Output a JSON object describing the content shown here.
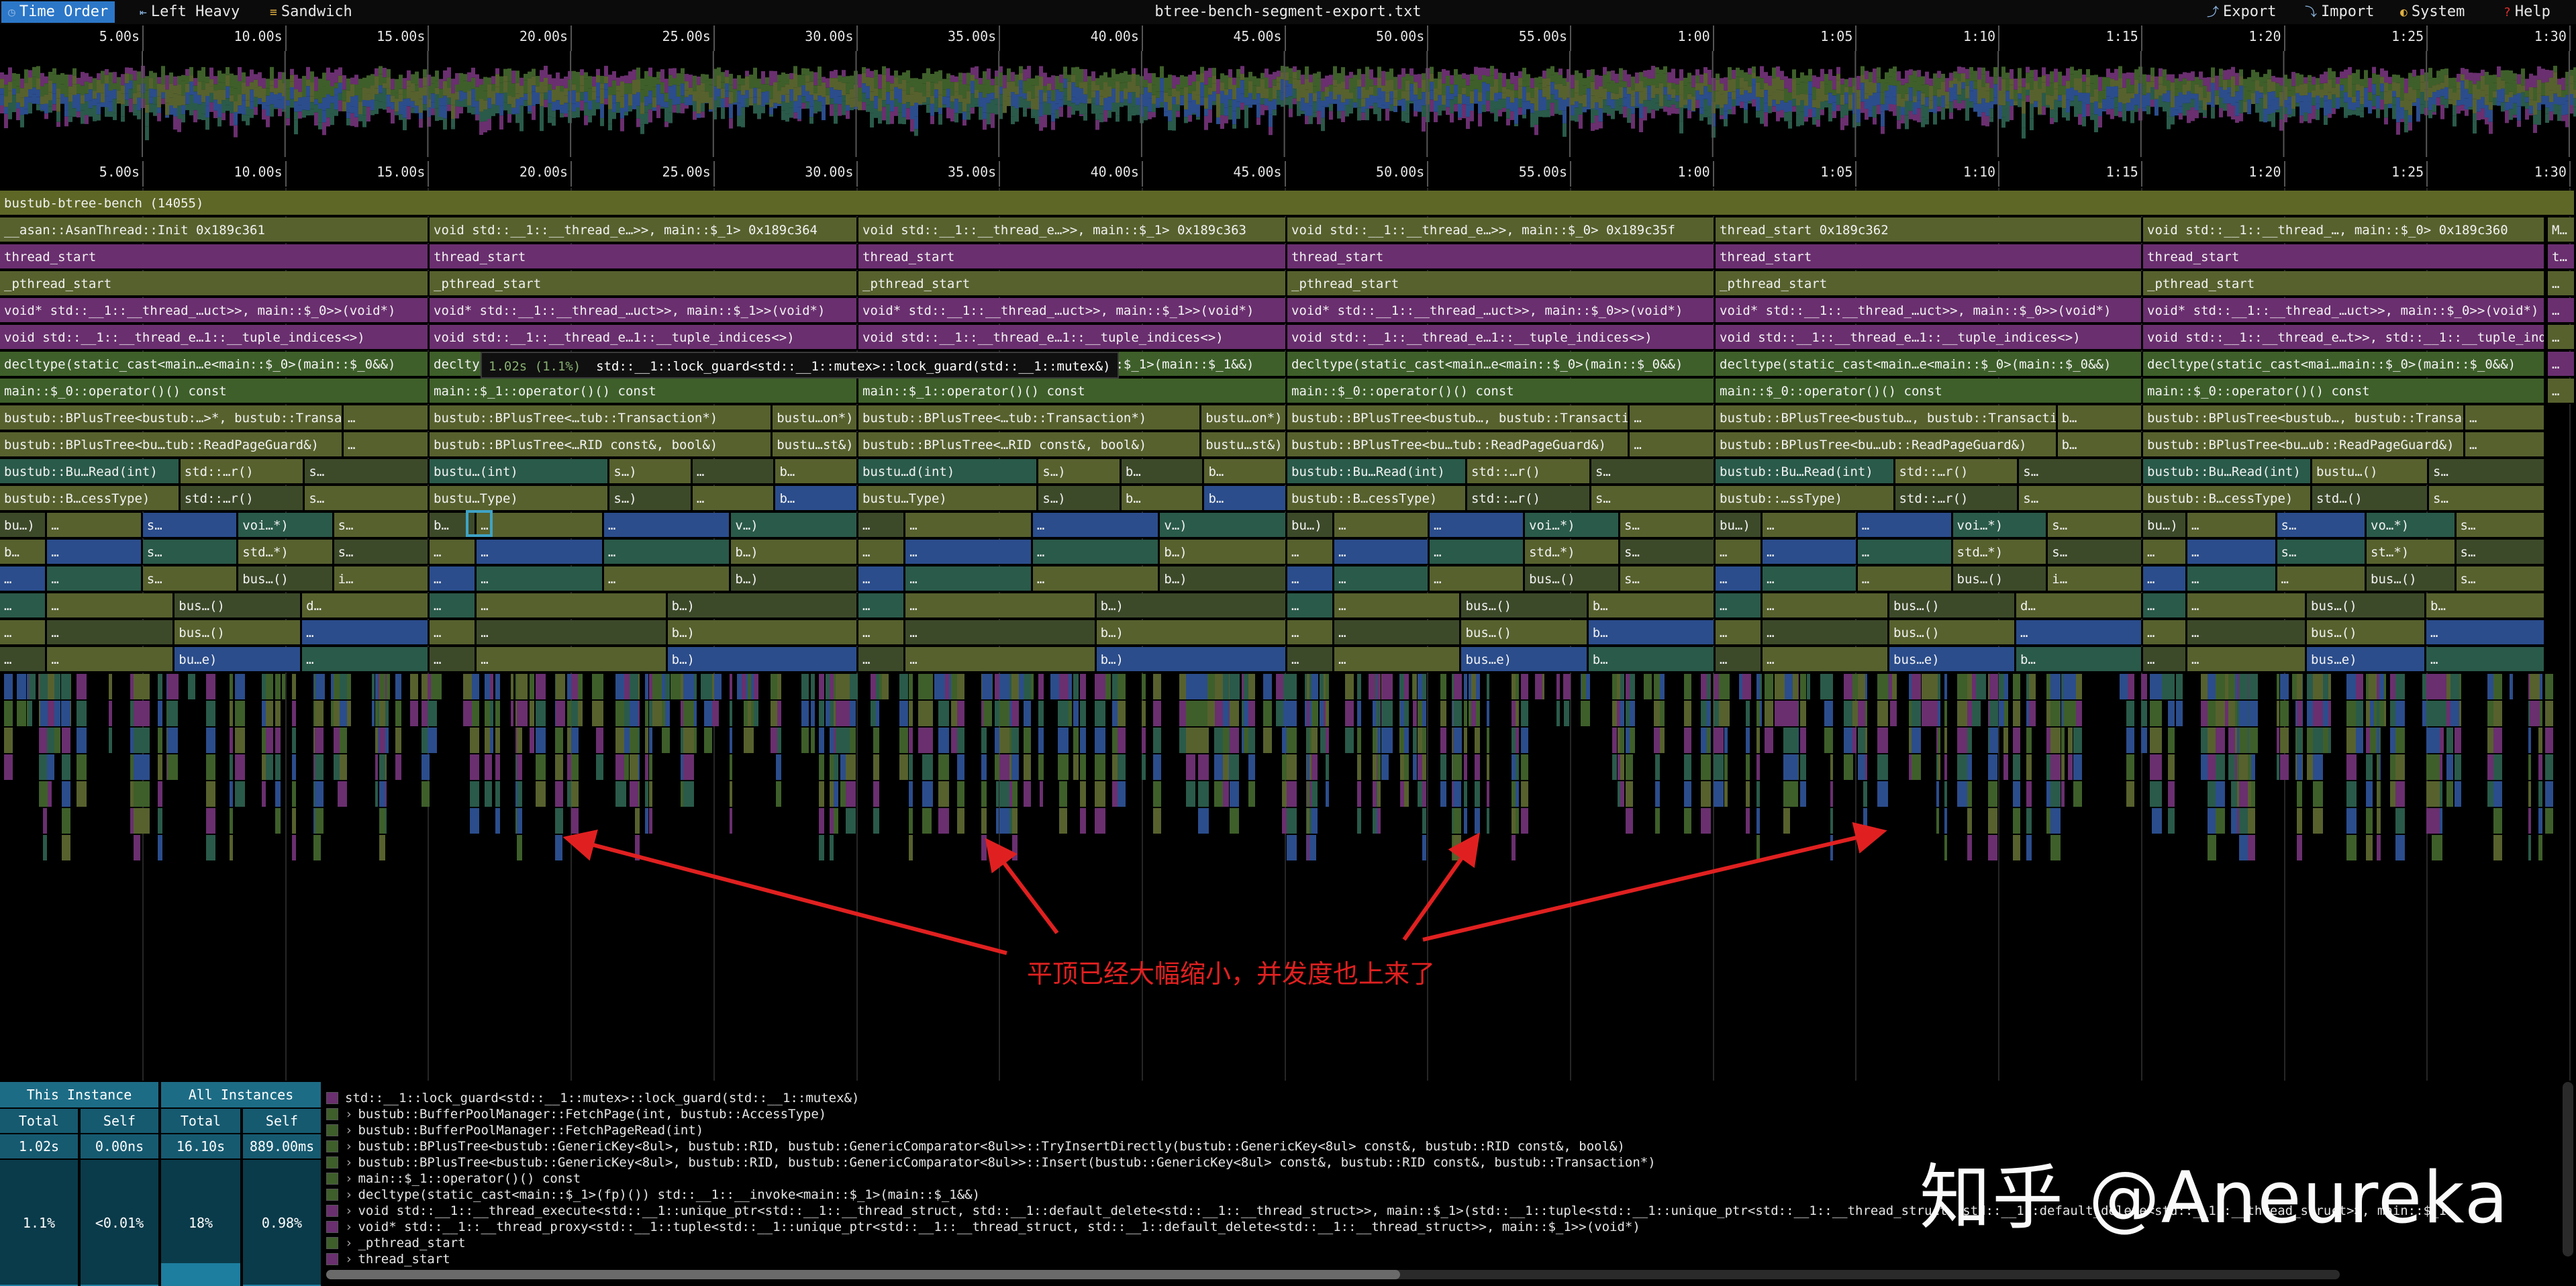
{
  "toolbar": {
    "tabs": [
      {
        "label": "Time Order",
        "icon": "clock-icon",
        "active": true
      },
      {
        "label": "Left Heavy",
        "icon": "left-heavy-icon",
        "active": false
      },
      {
        "label": "Sandwich",
        "icon": "sandwich-icon",
        "active": false
      }
    ],
    "title": "btree-bench-segment-export.txt",
    "actions": [
      {
        "label": "Export",
        "icon": "export-icon"
      },
      {
        "label": "Import",
        "icon": "import-icon"
      },
      {
        "label": "System",
        "icon": "palette-icon"
      },
      {
        "label": "Help",
        "icon": "help-icon"
      }
    ]
  },
  "ruler_ticks": [
    "5.00s",
    "10.00s",
    "15.00s",
    "20.00s",
    "25.00s",
    "30.00s",
    "35.00s",
    "40.00s",
    "45.00s",
    "50.00s",
    "55.00s",
    "1:00",
    "1:05",
    "1:10",
    "1:15",
    "1:20",
    "1:25",
    "1:30"
  ],
  "flame": {
    "root": "bustub-btree-bench (14055)",
    "threads": [
      {
        "rows": [
          "__asan::AsanThread::Init  0x189c361",
          "thread_start",
          "_pthread_start",
          "void* std::__1::__thread_…uct>>, main::$_0>>(void*)",
          "void std::__1::__thread_e…1::__tuple_indices<>)",
          "decltype(static_cast<main…e<main::$_0>(main::$_0&&)",
          "main::$_0::operator()() const"
        ],
        "blocks": [
          [
            "bustub::BPlusTree<bustub:…>*, bustub::Transaction*)",
            "…"
          ],
          [
            "bustub::BPlusTree<bu…tub::ReadPageGuard&)",
            "…"
          ],
          [
            "bustub::Bu…Read(int)",
            "std::…r()",
            "s…"
          ],
          [
            "bustub::B…cessType)",
            "std::…r()",
            "s…"
          ],
          [
            "bu…)",
            "…",
            "s…",
            "voi…*)",
            "s…"
          ],
          [
            "b…",
            "…",
            "s…",
            "std…*)",
            "s…"
          ],
          [
            "…",
            "…",
            "s…",
            "bus…()",
            "i…"
          ],
          [
            "…",
            "…",
            "bus…()",
            "d…"
          ],
          [
            "…",
            "…",
            "bus…()",
            "…"
          ],
          [
            "…",
            "…",
            "bu…e)",
            "…"
          ]
        ]
      },
      {
        "rows": [
          "void std::__1::__thread_e…>>, main::$_1>  0x189c364",
          "thread_start",
          "_pthread_start",
          "void* std::__1::__thread_…uct>>, main::$_1>>(void*)",
          "void std::__1::__thread_e…1::__tuple_indices<>)",
          "decltype(static_cast<main…e<main::$_1>(main::$_1&&)",
          "main::$_1::operator()() const"
        ],
        "blocks": [
          [
            "bustub::BPlusTree<…tub::Transaction*)",
            "bustu…on*)"
          ],
          [
            "bustub::BPlusTree<…RID const&, bool&)",
            "bustu…st&)"
          ],
          [
            "bustu…(int)",
            "s…)",
            "…",
            "b…"
          ],
          [
            "bustu…Type)",
            "s…)",
            "…",
            "b…"
          ],
          [
            "b…",
            "…",
            "…",
            "v…)"
          ],
          [
            "…",
            "…",
            "…",
            "b…)"
          ],
          [
            "…",
            "…",
            "…",
            "b…)"
          ],
          [
            "…",
            "…",
            "b…)"
          ],
          [
            "…",
            "…",
            "b…)"
          ],
          [
            "…",
            "…",
            "b…)"
          ]
        ]
      },
      {
        "rows": [
          "void std::__1::__thread_e…>>, main::$_1>  0x189c363",
          "thread_start",
          "_pthread_start",
          "void* std::__1::__thread_…uct>>, main::$_1>>(void*)",
          "void std::__1::__thread_e…1::__tuple_indices<>)",
          "decltype(static_cast<main…e<main::$_1>(main::$_1&&)",
          "main::$_1::operator()() const"
        ],
        "blocks": [
          [
            "bustub::BPlusTree<…tub::Transaction*)",
            "bustu…on*)"
          ],
          [
            "bustub::BPlusTree<…RID const&, bool&)",
            "bustu…st&)"
          ],
          [
            "bustu…d(int)",
            "s…)",
            "b…",
            "b…"
          ],
          [
            "bustu…Type)",
            "s…)",
            "b…",
            "b…"
          ],
          [
            "…",
            "…",
            "…",
            "v…)"
          ],
          [
            "…",
            "…",
            "…",
            "b…)"
          ],
          [
            "…",
            "…",
            "…",
            "b…)"
          ],
          [
            "…",
            "…",
            "b…)"
          ],
          [
            "…",
            "…",
            "b…)"
          ],
          [
            "…",
            "…",
            "b…)"
          ]
        ]
      },
      {
        "rows": [
          "void std::__1::__thread_e…>>, main::$_0>  0x189c35f",
          "thread_start",
          "_pthread_start",
          "void* std::__1::__thread_…uct>>, main::$_0>>(void*)",
          "void std::__1::__thread_e…1::__tuple_indices<>)",
          "decltype(static_cast<main…e<main::$_0>(main::$_0&&)",
          "main::$_0::operator()() const"
        ],
        "blocks": [
          [
            "bustub::BPlusTree<bustub…, bustub::Transaction*)",
            "…"
          ],
          [
            "bustub::BPlusTree<bu…tub::ReadPageGuard&)",
            "…"
          ],
          [
            "bustub::Bu…Read(int)",
            "std::…r()",
            "s…"
          ],
          [
            "bustub::B…cessType)",
            "std::…r()",
            "s…"
          ],
          [
            "bu…)",
            "…",
            "…",
            "voi…*)",
            "s…"
          ],
          [
            "…",
            "…",
            "…",
            "std…*)",
            "s…"
          ],
          [
            "…",
            "…",
            "…",
            "bus…()",
            "s…"
          ],
          [
            "…",
            "…",
            "bus…()",
            "b…"
          ],
          [
            "…",
            "…",
            "bus…()",
            "b…"
          ],
          [
            "…",
            "…",
            "bus…e)",
            "b…"
          ]
        ]
      },
      {
        "rows": [
          "thread_start  0x189c362",
          "thread_start",
          "_pthread_start",
          "void* std::__1::__thread_…uct>>, main::$_0>>(void*)",
          "void std::__1::__thread_e…1::__tuple_indices<>)",
          "decltype(static_cast<main…e<main::$_0>(main::$_0&&)",
          "main::$_0::operator()() const"
        ],
        "blocks": [
          [
            "bustub::BPlusTree<bustub…, bustub::Transaction*)",
            "b…"
          ],
          [
            "bustub::BPlusTree<bu…ub::ReadPageGuard&)",
            "b…"
          ],
          [
            "bustub::Bu…Read(int)",
            "std::…r()",
            "s…"
          ],
          [
            "bustub::…ssType)",
            "std::…r()",
            "s…"
          ],
          [
            "bu…)",
            "…",
            "…",
            "voi…*)",
            "s…"
          ],
          [
            "…",
            "…",
            "…",
            "std…*)",
            "s…"
          ],
          [
            "…",
            "…",
            "…",
            "bus…()",
            "i…"
          ],
          [
            "…",
            "…",
            "bus…()",
            "d…"
          ],
          [
            "…",
            "…",
            "bus…()",
            "…"
          ],
          [
            "…",
            "…",
            "bus…e)",
            "b…"
          ]
        ]
      },
      {
        "rows": [
          "void std::__1::__thread_…, main::$_0>  0x189c360",
          "thread_start",
          "_pthread_start",
          "void* std::__1::__thread_…uct>>, main::$_0>>(void*)",
          "void std::__1::__thread_e…t>>, std::__1::__tuple_indices<>)",
          "decltype(static_cast<mai…main::$_0>(main::$_0&&)",
          "main::$_0::operator()() const"
        ],
        "blocks": [
          [
            "bustub::BPlusTree<bustub…, bustub::Transaction*)",
            "…"
          ],
          [
            "bustub::BPlusTree<bu…ub::ReadPageGuard&)",
            "…"
          ],
          [
            "bustub::Bu…Read(int)",
            "bustu…()",
            "s…"
          ],
          [
            "bustub::B…cessType)",
            "std…()",
            "s…"
          ],
          [
            "bu…)",
            "…",
            "s…",
            "vo…*)",
            "s…"
          ],
          [
            "…",
            "…",
            "s…",
            "st…*)",
            "s…"
          ],
          [
            "…",
            "…",
            "…",
            "bus…()",
            "s…"
          ],
          [
            "…",
            "…",
            "bus…()",
            "b…"
          ],
          [
            "…",
            "…",
            "bus…()",
            "…"
          ],
          [
            "…",
            "…",
            "bus…e)",
            "…"
          ]
        ]
      }
    ],
    "tail_labels": [
      "M…",
      "t…",
      "…",
      "…",
      "…",
      "…",
      "…"
    ],
    "tooltip": {
      "time": "1.02s (1.1%)",
      "name": "std::__1::lock_guard<std::__1::mutex>::lock_guard(std::__1::mutex&)"
    }
  },
  "annotation": {
    "text": "平顶已经大幅缩小，并发度也上来了",
    "color": "#e02020"
  },
  "stats": {
    "this_instance": {
      "title": "This Instance",
      "total_label": "Total",
      "self_label": "Self",
      "total": "1.02s",
      "self": "0.00ns",
      "total_pct": "1.1%",
      "self_pct": "<0.01%"
    },
    "all_instances": {
      "title": "All Instances",
      "total_label": "Total",
      "self_label": "Self",
      "total": "16.10s",
      "self": "889.00ms",
      "total_pct": "18%",
      "self_pct": "0.98%"
    },
    "this_total_fill": 0.011,
    "this_self_fill": 0.0001,
    "all_total_fill": 0.18,
    "all_self_fill": 0.0098
  },
  "call_stack": [
    {
      "text": "std::__1::lock_guard<std::__1::mutex>::lock_guard(std::__1::mutex&)",
      "color": "#6a2f6f",
      "chevron": false
    },
    {
      "text": "bustub::BufferPoolManager::FetchPage(int, bustub::AccessType)",
      "color": "#3e5f2a",
      "chevron": true
    },
    {
      "text": "bustub::BufferPoolManager::FetchPageRead(int)",
      "color": "#3e5f2a",
      "chevron": true
    },
    {
      "text": "bustub::BPlusTree<bustub::GenericKey<8ul>, bustub::RID, bustub::GenericComparator<8ul>>::TryInsertDirectly(bustub::GenericKey<8ul> const&, bustub::RID const&, bool&)",
      "color": "#3e5f2a",
      "chevron": true
    },
    {
      "text": "bustub::BPlusTree<bustub::GenericKey<8ul>, bustub::RID, bustub::GenericComparator<8ul>>::Insert(bustub::GenericKey<8ul> const&, bustub::RID const&, bustub::Transaction*)",
      "color": "#3e5f2a",
      "chevron": true
    },
    {
      "text": "main::$_1::operator()() const",
      "color": "#3e5f2a",
      "chevron": true
    },
    {
      "text": "decltype(static_cast<main::$_1>(fp)()) std::__1::__invoke<main::$_1>(main::$_1&&)",
      "color": "#3e5f2a",
      "chevron": true
    },
    {
      "text": "void std::__1::__thread_execute<std::__1::unique_ptr<std::__1::__thread_struct, std::__1::default_delete<std::__1::__thread_struct>>, main::$_1>(std::__1::tuple<std::__1::unique_ptr<std::__1::__thread_struct, std::__1::default_delete<std::__1::__thread_struct>>, main::$_1",
      "color": "#6a2f6f",
      "chevron": true
    },
    {
      "text": "void* std::__1::__thread_proxy<std::__1::tuple<std::__1::unique_ptr<std::__1::__thread_struct, std::__1::default_delete<std::__1::__thread_struct>>, main::$_1>>(void*)",
      "color": "#6a2f6f",
      "chevron": true
    },
    {
      "text": "_pthread_start",
      "color": "#3e5f2a",
      "chevron": true
    },
    {
      "text": "thread_start",
      "color": "#6a2f6f",
      "chevron": true
    }
  ],
  "watermark": "知乎 @Aneureka"
}
